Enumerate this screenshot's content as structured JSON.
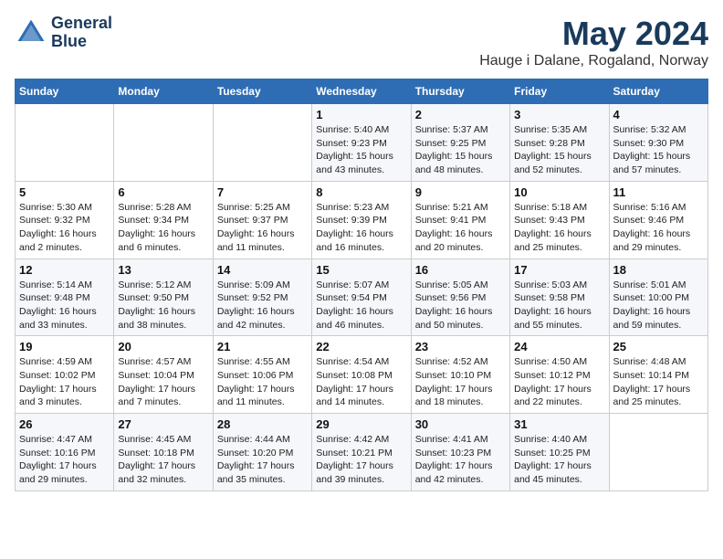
{
  "header": {
    "logo_line1": "General",
    "logo_line2": "Blue",
    "month_year": "May 2024",
    "location": "Hauge i Dalane, Rogaland, Norway"
  },
  "days_of_week": [
    "Sunday",
    "Monday",
    "Tuesday",
    "Wednesday",
    "Thursday",
    "Friday",
    "Saturday"
  ],
  "weeks": [
    [
      {
        "day": "",
        "info": ""
      },
      {
        "day": "",
        "info": ""
      },
      {
        "day": "",
        "info": ""
      },
      {
        "day": "1",
        "info": "Sunrise: 5:40 AM\nSunset: 9:23 PM\nDaylight: 15 hours\nand 43 minutes."
      },
      {
        "day": "2",
        "info": "Sunrise: 5:37 AM\nSunset: 9:25 PM\nDaylight: 15 hours\nand 48 minutes."
      },
      {
        "day": "3",
        "info": "Sunrise: 5:35 AM\nSunset: 9:28 PM\nDaylight: 15 hours\nand 52 minutes."
      },
      {
        "day": "4",
        "info": "Sunrise: 5:32 AM\nSunset: 9:30 PM\nDaylight: 15 hours\nand 57 minutes."
      }
    ],
    [
      {
        "day": "5",
        "info": "Sunrise: 5:30 AM\nSunset: 9:32 PM\nDaylight: 16 hours\nand 2 minutes."
      },
      {
        "day": "6",
        "info": "Sunrise: 5:28 AM\nSunset: 9:34 PM\nDaylight: 16 hours\nand 6 minutes."
      },
      {
        "day": "7",
        "info": "Sunrise: 5:25 AM\nSunset: 9:37 PM\nDaylight: 16 hours\nand 11 minutes."
      },
      {
        "day": "8",
        "info": "Sunrise: 5:23 AM\nSunset: 9:39 PM\nDaylight: 16 hours\nand 16 minutes."
      },
      {
        "day": "9",
        "info": "Sunrise: 5:21 AM\nSunset: 9:41 PM\nDaylight: 16 hours\nand 20 minutes."
      },
      {
        "day": "10",
        "info": "Sunrise: 5:18 AM\nSunset: 9:43 PM\nDaylight: 16 hours\nand 25 minutes."
      },
      {
        "day": "11",
        "info": "Sunrise: 5:16 AM\nSunset: 9:46 PM\nDaylight: 16 hours\nand 29 minutes."
      }
    ],
    [
      {
        "day": "12",
        "info": "Sunrise: 5:14 AM\nSunset: 9:48 PM\nDaylight: 16 hours\nand 33 minutes."
      },
      {
        "day": "13",
        "info": "Sunrise: 5:12 AM\nSunset: 9:50 PM\nDaylight: 16 hours\nand 38 minutes."
      },
      {
        "day": "14",
        "info": "Sunrise: 5:09 AM\nSunset: 9:52 PM\nDaylight: 16 hours\nand 42 minutes."
      },
      {
        "day": "15",
        "info": "Sunrise: 5:07 AM\nSunset: 9:54 PM\nDaylight: 16 hours\nand 46 minutes."
      },
      {
        "day": "16",
        "info": "Sunrise: 5:05 AM\nSunset: 9:56 PM\nDaylight: 16 hours\nand 50 minutes."
      },
      {
        "day": "17",
        "info": "Sunrise: 5:03 AM\nSunset: 9:58 PM\nDaylight: 16 hours\nand 55 minutes."
      },
      {
        "day": "18",
        "info": "Sunrise: 5:01 AM\nSunset: 10:00 PM\nDaylight: 16 hours\nand 59 minutes."
      }
    ],
    [
      {
        "day": "19",
        "info": "Sunrise: 4:59 AM\nSunset: 10:02 PM\nDaylight: 17 hours\nand 3 minutes."
      },
      {
        "day": "20",
        "info": "Sunrise: 4:57 AM\nSunset: 10:04 PM\nDaylight: 17 hours\nand 7 minutes."
      },
      {
        "day": "21",
        "info": "Sunrise: 4:55 AM\nSunset: 10:06 PM\nDaylight: 17 hours\nand 11 minutes."
      },
      {
        "day": "22",
        "info": "Sunrise: 4:54 AM\nSunset: 10:08 PM\nDaylight: 17 hours\nand 14 minutes."
      },
      {
        "day": "23",
        "info": "Sunrise: 4:52 AM\nSunset: 10:10 PM\nDaylight: 17 hours\nand 18 minutes."
      },
      {
        "day": "24",
        "info": "Sunrise: 4:50 AM\nSunset: 10:12 PM\nDaylight: 17 hours\nand 22 minutes."
      },
      {
        "day": "25",
        "info": "Sunrise: 4:48 AM\nSunset: 10:14 PM\nDaylight: 17 hours\nand 25 minutes."
      }
    ],
    [
      {
        "day": "26",
        "info": "Sunrise: 4:47 AM\nSunset: 10:16 PM\nDaylight: 17 hours\nand 29 minutes."
      },
      {
        "day": "27",
        "info": "Sunrise: 4:45 AM\nSunset: 10:18 PM\nDaylight: 17 hours\nand 32 minutes."
      },
      {
        "day": "28",
        "info": "Sunrise: 4:44 AM\nSunset: 10:20 PM\nDaylight: 17 hours\nand 35 minutes."
      },
      {
        "day": "29",
        "info": "Sunrise: 4:42 AM\nSunset: 10:21 PM\nDaylight: 17 hours\nand 39 minutes."
      },
      {
        "day": "30",
        "info": "Sunrise: 4:41 AM\nSunset: 10:23 PM\nDaylight: 17 hours\nand 42 minutes."
      },
      {
        "day": "31",
        "info": "Sunrise: 4:40 AM\nSunset: 10:25 PM\nDaylight: 17 hours\nand 45 minutes."
      },
      {
        "day": "",
        "info": ""
      }
    ]
  ]
}
